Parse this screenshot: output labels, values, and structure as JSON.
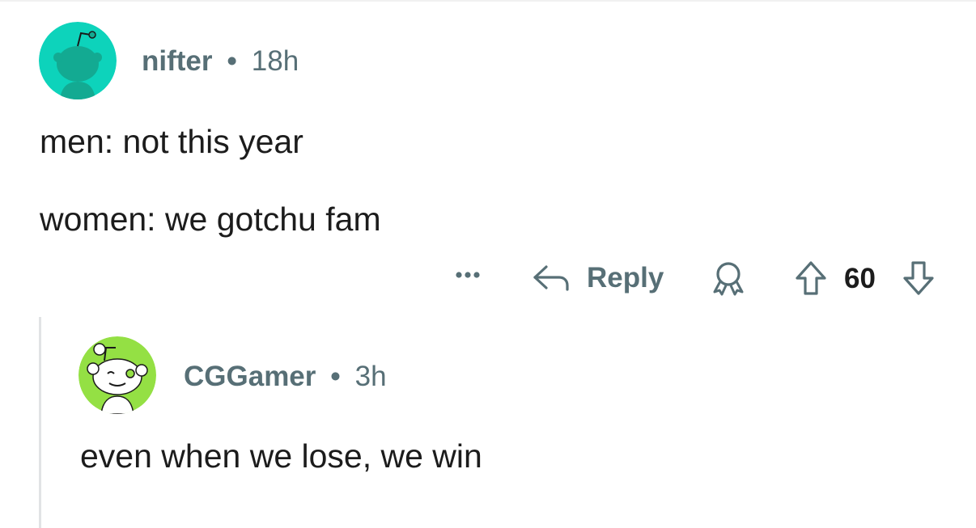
{
  "colors": {
    "meta_text": "#576f76",
    "body_text": "#1c1c1c",
    "thread_line": "#e1e3e5",
    "nifter_avatar_bg": "#0dd3bb",
    "cggamer_avatar_bg": "#94e044"
  },
  "comments": [
    {
      "author": "nifter",
      "separator": "•",
      "time": "18h",
      "avatar_icon": "snoo-avatar-icon",
      "lines": [
        "men: not this year",
        "women: we gotchu fam"
      ],
      "actions": {
        "more_icon": "more-dots-icon",
        "reply_label": "Reply",
        "award_icon": "award-icon",
        "upvote_icon": "upvote-arrow-icon",
        "score": "60",
        "downvote_icon": "downvote-arrow-icon"
      }
    },
    {
      "author": "CGGamer",
      "separator": "•",
      "time": "3h",
      "avatar_icon": "snoo-avatar-icon",
      "lines": [
        "even when we lose, we win"
      ]
    }
  ]
}
